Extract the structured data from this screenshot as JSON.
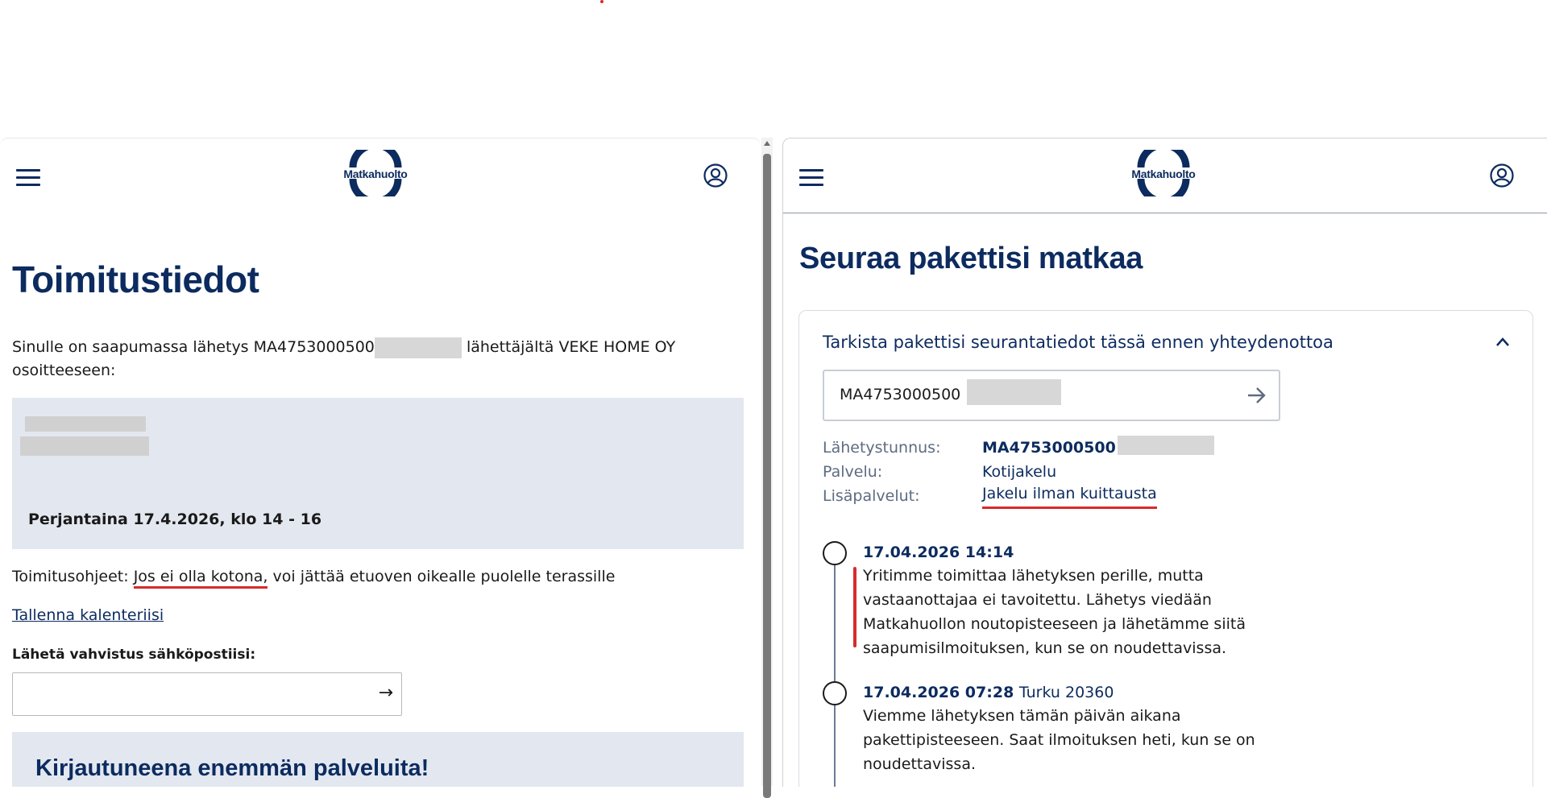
{
  "logo_text": "Matkahuolto",
  "left": {
    "title": "Toimitustiedot",
    "intro_prefix": "Sinulle on saapumassa lähetys MA4753000500",
    "intro_suffix": "lähettäjältä VEKE HOME OY osoitteeseen:",
    "delivery_slot": "Perjantaina 17.4.2026, klo 14 - 16",
    "instructions_label": "Toimitusohjeet:",
    "instructions_link": "Jos ei olla kotona,",
    "instructions_rest": "voi jättää etuoven oikealle puolelle terassille",
    "calendar_link": "Tallenna kalenteriisi",
    "email_label": "Lähetä vahvistus sähköpostiisi:",
    "email_placeholder": "",
    "email_submit": "→",
    "promo_title": "Kirjautuneena enemmän palveluita!"
  },
  "right": {
    "title": "Seuraa pakettisi matkaa",
    "card_heading": "Tarkista pakettisi seurantatiedot tässä ennen yhteydenottoa",
    "tracking_input_value": "MA4753000500",
    "details": [
      {
        "key": "Lähetystunnus:",
        "value": "MA4753000500"
      },
      {
        "key": "Palvelu:",
        "value": "Kotijakelu"
      },
      {
        "key": "Lisäpalvelut:",
        "value": "Jakelu ilman kuittausta"
      }
    ],
    "events": [
      {
        "date": "17.04.2026 14:14",
        "location": "",
        "text": "Yritimme toimittaa lähetyksen perille, mutta vastaanottajaa ei tavoitettu. Lähetys viedään Matkahuollon noutopisteeseen ja lähetämme siitä saapumisilmoituksen, kun se on noudettavissa."
      },
      {
        "date": "17.04.2026 07:28",
        "location": "Turku 20360",
        "text": "Viemme lähetyksen tämän päivän aikana pakettipisteeseen. Saat ilmoituksen heti, kun se on noudettavissa."
      }
    ]
  },
  "colors": {
    "brand": "#0c2b5f",
    "highlight": "#d62b2b",
    "panel": "#e3e8f0"
  }
}
